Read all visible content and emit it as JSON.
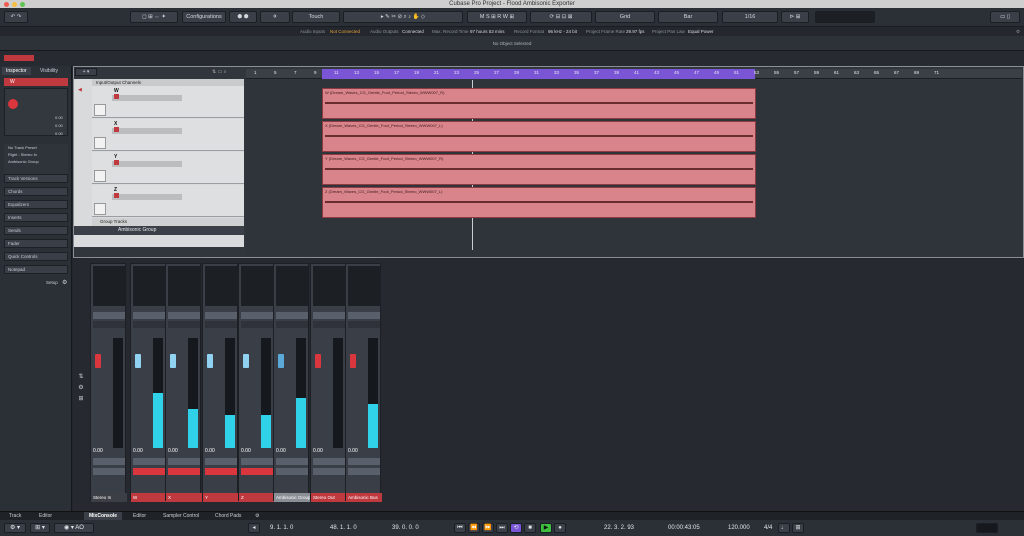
{
  "window": {
    "title": "Cubase Pro Project - Flood Ambisonic Exporter"
  },
  "toolbar": {
    "configurations": "Configurations",
    "automation_mode": "Touch",
    "grid_type": "Grid",
    "grid_unit": "Bar",
    "quantize": "1/16"
  },
  "statusline": {
    "audio_inputs_label": "Audio Inputs",
    "audio_inputs_value": "Not Connected",
    "audio_outputs_label": "Audio Outputs",
    "audio_outputs_value": "Connected",
    "max_record_label": "Max. Record Time",
    "max_record_value": "97 hours 53 mins",
    "record_format_label": "Record Format",
    "record_format_value": "96 kHz - 24 bit",
    "frame_rate_label": "Project Frame Rate",
    "frame_rate_value": "29.97 fps",
    "pan_law_label": "Project Pan Law",
    "pan_law_value": "Equal Power"
  },
  "info_line": "No Object Selected",
  "inspector": {
    "tab_inspector": "Inspector",
    "tab_visibility": "Visibility",
    "track_name": "W",
    "preset": "No Track Preset",
    "routing": "Right : Stereo In",
    "group": "Ambisonic Group",
    "sections": [
      "Track Versions",
      "Chords",
      "Equalizers",
      "Inserts",
      "Sends",
      "Fader",
      "Quick Controls",
      "Notepad"
    ],
    "setup": "Setup",
    "val1": "0.00",
    "val2": "0.00",
    "val3": "0.00"
  },
  "tracklist": {
    "folder": "Input/Output Channels",
    "tracks": [
      "W",
      "X",
      "Y",
      "Z"
    ],
    "group_folder": "Group Tracks",
    "group_track": "Ambisonic Group",
    "btn_m": "M",
    "btn_s": "S"
  },
  "ruler": {
    "ticks": [
      "1",
      "5",
      "7",
      "9",
      "11",
      "13",
      "15",
      "17",
      "19",
      "21",
      "23",
      "25",
      "27",
      "29",
      "31",
      "33",
      "35",
      "37",
      "39",
      "41",
      "43",
      "45",
      "47",
      "49",
      "51",
      "53",
      "55",
      "57",
      "59",
      "61",
      "63",
      "65",
      "67",
      "69",
      "71"
    ]
  },
  "clips": [
    "W (Dream_Waves_CG_Gentle_Foot_Period_Stereo_WWW007_R)",
    "X (Dream_Waves_CG_Gentle_Foot_Period_Stereo_WWW007_L)",
    "Y (Dream_Waves_CG_Gentle_Foot_Period_Stereo_WWW007_R)",
    "Z (Dream_Waves_CG_Gentle_Foot_Period_Stereo_WWW007_L)"
  ],
  "mixer": {
    "channels": [
      {
        "name": "Stereo In",
        "value": "0.00",
        "color": "#3c3f45",
        "fader": "#d9363e",
        "level": 0
      },
      {
        "name": "W",
        "value": "0.00",
        "color": "#c0393f",
        "fader": "#8fd2f2",
        "level": 0.5
      },
      {
        "name": "X",
        "value": "0.00",
        "color": "#c0393f",
        "fader": "#8fd2f2",
        "level": 0.35
      },
      {
        "name": "Y",
        "value": "0.00",
        "color": "#c0393f",
        "fader": "#8fd2f2",
        "level": 0.3
      },
      {
        "name": "Z",
        "value": "0.00",
        "color": "#c0393f",
        "fader": "#8fd2f2",
        "level": 0.3
      },
      {
        "name": "Ambisonic Group",
        "value": "0.00",
        "color": "#8a8f96",
        "fader": "#5aa9d9",
        "level": 0.45
      },
      {
        "name": "Stereo Out",
        "value": "0.00",
        "color": "#c0393f",
        "fader": "#d9363e",
        "level": 0
      },
      {
        "name": "Ambisonic Bus",
        "value": "0.00",
        "color": "#c0393f",
        "fader": "#d9363e",
        "level": 0.4
      }
    ],
    "numbers": [
      "1",
      "2",
      "3",
      "4",
      "5"
    ]
  },
  "bottom_tabs": [
    "Track",
    "Editor",
    "MixConsole",
    "Editor",
    "Sampler Control",
    "Chord Pads"
  ],
  "transport": {
    "left_locator": "9. 1. 1. 0",
    "right_locator": "48. 1. 1. 0",
    "position1": "39. 0. 0. 0",
    "position2": "22. 3. 2. 93",
    "time": "00:00:43:05",
    "tempo": "120.000",
    "signature": "4/4"
  }
}
